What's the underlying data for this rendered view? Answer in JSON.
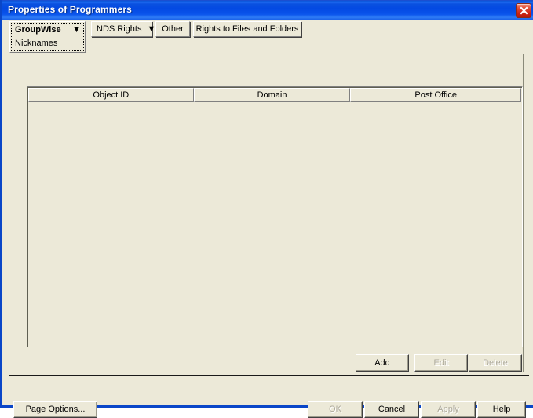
{
  "window": {
    "title": "Properties of Programmers",
    "close_icon": "close-icon",
    "titlebar_color": "#0a51e0",
    "face_color": "#ece9d8"
  },
  "tabs": [
    {
      "label": "GroupWise",
      "sub_label": "Nicknames",
      "has_dropdown": true,
      "selected": true,
      "arrow": "▼"
    },
    {
      "label": "NDS Rights",
      "has_dropdown": true,
      "selected": false,
      "arrow": "▼"
    },
    {
      "label": "Other",
      "has_dropdown": false,
      "selected": false
    },
    {
      "label": "Rights to Files and Folders",
      "has_dropdown": false,
      "selected": false
    }
  ],
  "list": {
    "columns": [
      {
        "label": "Object ID"
      },
      {
        "label": "Domain"
      },
      {
        "label": "Post Office"
      }
    ],
    "rows": [],
    "buttons": [
      {
        "label": "Add",
        "enabled": true
      },
      {
        "label": "Edit",
        "enabled": false
      },
      {
        "label": "Delete",
        "enabled": false
      }
    ]
  },
  "bottom_bar": {
    "page_options": {
      "label": "Page Options...",
      "enabled": true
    },
    "ok": {
      "label": "OK",
      "enabled": false
    },
    "cancel": {
      "label": "Cancel",
      "enabled": true
    },
    "apply": {
      "label": "Apply",
      "enabled": false
    },
    "help": {
      "label": "Help",
      "enabled": true
    }
  }
}
